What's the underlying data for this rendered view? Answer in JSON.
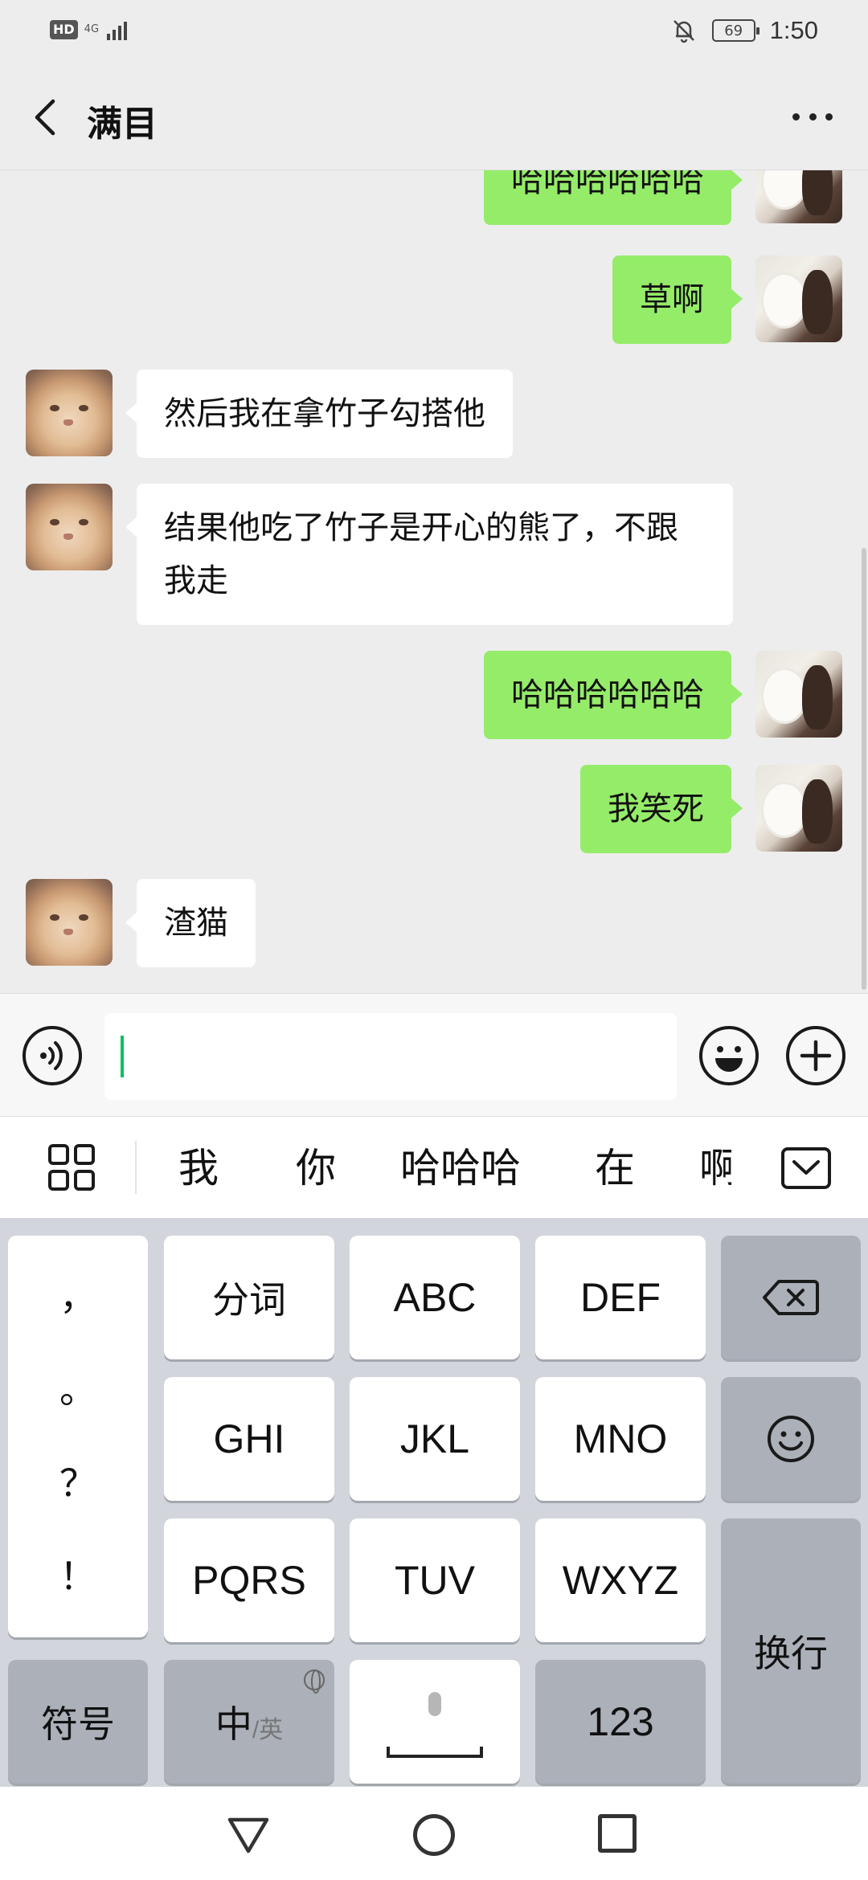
{
  "status_bar": {
    "hd": "HD",
    "network": "4G",
    "battery": "69",
    "time": "1:50"
  },
  "header": {
    "title": "满目"
  },
  "messages": [
    {
      "side": "right",
      "text": "哈哈哈哈哈哈"
    },
    {
      "side": "right",
      "text": "草啊"
    },
    {
      "side": "left",
      "text": "然后我在拿竹子勾搭他"
    },
    {
      "side": "left",
      "text": "结果他吃了竹子是开心的熊了，不跟我走"
    },
    {
      "side": "right",
      "text": "哈哈哈哈哈哈"
    },
    {
      "side": "right",
      "text": "我笑死"
    },
    {
      "side": "left",
      "text": "渣猫"
    }
  ],
  "input": {
    "value": ""
  },
  "candidates": [
    "我",
    "你",
    "哈哈哈",
    "在",
    "啊"
  ],
  "keyboard": {
    "punctuation": [
      "，",
      "。",
      "？",
      "！"
    ],
    "row1": [
      "分词",
      "ABC",
      "DEF"
    ],
    "row2": [
      "GHI",
      "JKL",
      "MNO"
    ],
    "row3": [
      "PQRS",
      "TUV",
      "WXYZ"
    ],
    "symbols": "符号",
    "lang_zh": "中",
    "lang_en": "/英",
    "numbers": "123",
    "enter": "换行"
  },
  "icons": {
    "back": "chevron-left-icon",
    "more": "more-icon",
    "voice": "voice-icon",
    "emoji": "emoji-icon",
    "plus": "plus-icon",
    "grid": "grid-icon",
    "collapse": "keyboard-collapse-icon",
    "delete": "backspace-icon",
    "globe": "globe-icon",
    "mic": "mic-icon"
  },
  "colors": {
    "sent_bubble": "#95ec69",
    "received_bubble": "#ffffff",
    "background": "#ededed",
    "cursor": "#07c160"
  }
}
